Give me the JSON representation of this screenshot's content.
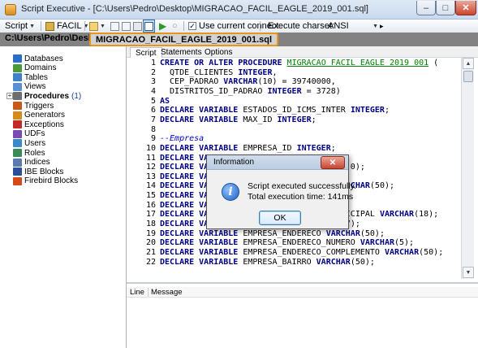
{
  "window": {
    "title": "Script Executive - [C:\\Users\\Pedro\\Desktop\\MIGRACAO_FACIL_EAGLE_2019_001.sql]",
    "minimize": "–",
    "maximize": "□",
    "close": "✕"
  },
  "toolbar": {
    "script_label": "Script",
    "db_label": "FACIL",
    "use_current_connect": "Use current connect",
    "execute_charset_label": "Execute charset:",
    "charset_value": "ANSI"
  },
  "pathbar": {
    "path_prefix": "C:\\Users\\Pedro\\Desktop\\",
    "file_name": "MIGRACAO_FACIL_EAGLE_2019_001.sql"
  },
  "tree": {
    "items": [
      {
        "label": "Databases",
        "color": "#2a6ec9"
      },
      {
        "label": "Domains",
        "color": "#4a9a3a"
      },
      {
        "label": "Tables",
        "color": "#3f7fc4"
      },
      {
        "label": "Views",
        "color": "#5b8fd4"
      },
      {
        "label": "Procedures",
        "count": "(1)",
        "color": "#6d6d6d"
      },
      {
        "label": "Triggers",
        "color": "#c9591b"
      },
      {
        "label": "Generators",
        "color": "#d68a1a"
      },
      {
        "label": "Exceptions",
        "color": "#c22a2a"
      },
      {
        "label": "UDFs",
        "color": "#7a4ab0"
      },
      {
        "label": "Users",
        "color": "#3a8ac9"
      },
      {
        "label": "Roles",
        "color": "#3a8a5a"
      },
      {
        "label": "Indices",
        "color": "#5a7ab0"
      },
      {
        "label": "IBE Blocks",
        "color": "#2a4e9a"
      },
      {
        "label": "Firebird Blocks",
        "color": "#d64a1a"
      }
    ]
  },
  "tabs": [
    "Script",
    "Statements",
    "Options"
  ],
  "editor": {
    "lines": [
      {
        "n": "1",
        "parts": [
          {
            "t": "kw",
            "s": "CREATE OR ALTER PROCEDURE "
          },
          {
            "t": "id",
            "s": "MIGRACAO FACIL EAGLE 2019 001"
          },
          {
            "t": "",
            "s": " ("
          }
        ]
      },
      {
        "n": "2",
        "parts": [
          {
            "t": "",
            "s": "  QTDE_CLIENTES "
          },
          {
            "t": "kw",
            "s": "INTEGER"
          },
          {
            "t": "",
            "s": ","
          }
        ]
      },
      {
        "n": "3",
        "parts": [
          {
            "t": "",
            "s": "  CEP_PADRAO "
          },
          {
            "t": "kw",
            "s": "VARCHAR"
          },
          {
            "t": "",
            "s": "(10) = 39740000,"
          }
        ]
      },
      {
        "n": "4",
        "parts": [
          {
            "t": "",
            "s": "  DISTRITOS_ID_PADRAO "
          },
          {
            "t": "kw",
            "s": "INTEGER"
          },
          {
            "t": "",
            "s": " = 3728)"
          }
        ]
      },
      {
        "n": "5",
        "parts": [
          {
            "t": "kw",
            "s": "AS"
          }
        ]
      },
      {
        "n": "6",
        "parts": [
          {
            "t": "kw",
            "s": "DECLARE VARIABLE"
          },
          {
            "t": "",
            "s": " ESTADOS_ID_ICMS_INTER "
          },
          {
            "t": "kw",
            "s": "INTEGER"
          },
          {
            "t": "",
            "s": ";"
          }
        ]
      },
      {
        "n": "7",
        "parts": [
          {
            "t": "kw",
            "s": "DECLARE VARIABLE"
          },
          {
            "t": "",
            "s": " MAX_ID "
          },
          {
            "t": "kw",
            "s": "INTEGER"
          },
          {
            "t": "",
            "s": ";"
          }
        ]
      },
      {
        "n": "8",
        "parts": []
      },
      {
        "n": "9",
        "parts": [
          {
            "t": "cm",
            "s": "--Empresa"
          }
        ]
      },
      {
        "n": "10",
        "parts": [
          {
            "t": "kw",
            "s": "DECLARE VARIABLE"
          },
          {
            "t": "",
            "s": " EMPRESA_ID "
          },
          {
            "t": "kw",
            "s": "INTEGER"
          },
          {
            "t": "",
            "s": ";"
          }
        ]
      },
      {
        "n": "11",
        "parts": [
          {
            "t": "kw",
            "s": "DECLARE VAR"
          }
        ]
      },
      {
        "n": "12",
        "parts": [
          {
            "t": "kw",
            "s": "DECLARE VAR"
          },
          {
            "t": "",
            "s": "                            0);"
          }
        ]
      },
      {
        "n": "13",
        "parts": [
          {
            "t": "kw",
            "s": "DECLARE VAR"
          }
        ]
      },
      {
        "n": "14",
        "parts": [
          {
            "t": "kw",
            "s": "DECLARE VAR"
          },
          {
            "t": "",
            "s": "                            "
          },
          {
            "t": "kw",
            "s": "CHAR"
          },
          {
            "t": "",
            "s": "(50);"
          }
        ]
      },
      {
        "n": "15",
        "parts": [
          {
            "t": "kw",
            "s": "DECLARE VAR"
          }
        ]
      },
      {
        "n": "16",
        "parts": [
          {
            "t": "kw",
            "s": "DECLARE VAR"
          }
        ]
      },
      {
        "n": "17",
        "parts": [
          {
            "t": "kw",
            "s": "DECLARE VARIABLE"
          },
          {
            "t": "",
            "s": " EMPRESA_INSCRICAO_MUNICIPAL "
          },
          {
            "t": "kw",
            "s": "VARCHAR"
          },
          {
            "t": "",
            "s": "(18);"
          }
        ]
      },
      {
        "n": "18",
        "parts": [
          {
            "t": "kw",
            "s": "DECLARE VARIABLE"
          },
          {
            "t": "",
            "s": " EMPRESA_CNAE "
          },
          {
            "t": "kw",
            "s": "VARCHAR"
          },
          {
            "t": "",
            "s": "(7);"
          }
        ]
      },
      {
        "n": "19",
        "parts": [
          {
            "t": "kw",
            "s": "DECLARE VARIABLE"
          },
          {
            "t": "",
            "s": " EMPRESA_ENDERECO "
          },
          {
            "t": "kw",
            "s": "VARCHAR"
          },
          {
            "t": "",
            "s": "(50);"
          }
        ]
      },
      {
        "n": "20",
        "parts": [
          {
            "t": "kw",
            "s": "DECLARE VARIABLE"
          },
          {
            "t": "",
            "s": " EMPRESA_ENDERECO_NUMERO "
          },
          {
            "t": "kw",
            "s": "VARCHAR"
          },
          {
            "t": "",
            "s": "(5);"
          }
        ]
      },
      {
        "n": "21",
        "parts": [
          {
            "t": "kw",
            "s": "DECLARE VARIABLE"
          },
          {
            "t": "",
            "s": " EMPRESA_ENDERECO_COMPLEMENTO "
          },
          {
            "t": "kw",
            "s": "VARCHAR"
          },
          {
            "t": "",
            "s": "(50);"
          }
        ]
      },
      {
        "n": "22",
        "parts": [
          {
            "t": "kw",
            "s": "DECLARE VARIABLE"
          },
          {
            "t": "",
            "s": " EMPRESA_BAIRRO "
          },
          {
            "t": "kw",
            "s": "VARCHAR"
          },
          {
            "t": "",
            "s": "(50);"
          }
        ]
      }
    ]
  },
  "messages": {
    "col_line": "Line",
    "col_message": "Message"
  },
  "dialog": {
    "title": "Information",
    "close": "✕",
    "icon_glyph": "i",
    "message_line1": "Script executed successfully.",
    "message_line2": "Total execution time: 141ms",
    "ok_label": "OK"
  }
}
